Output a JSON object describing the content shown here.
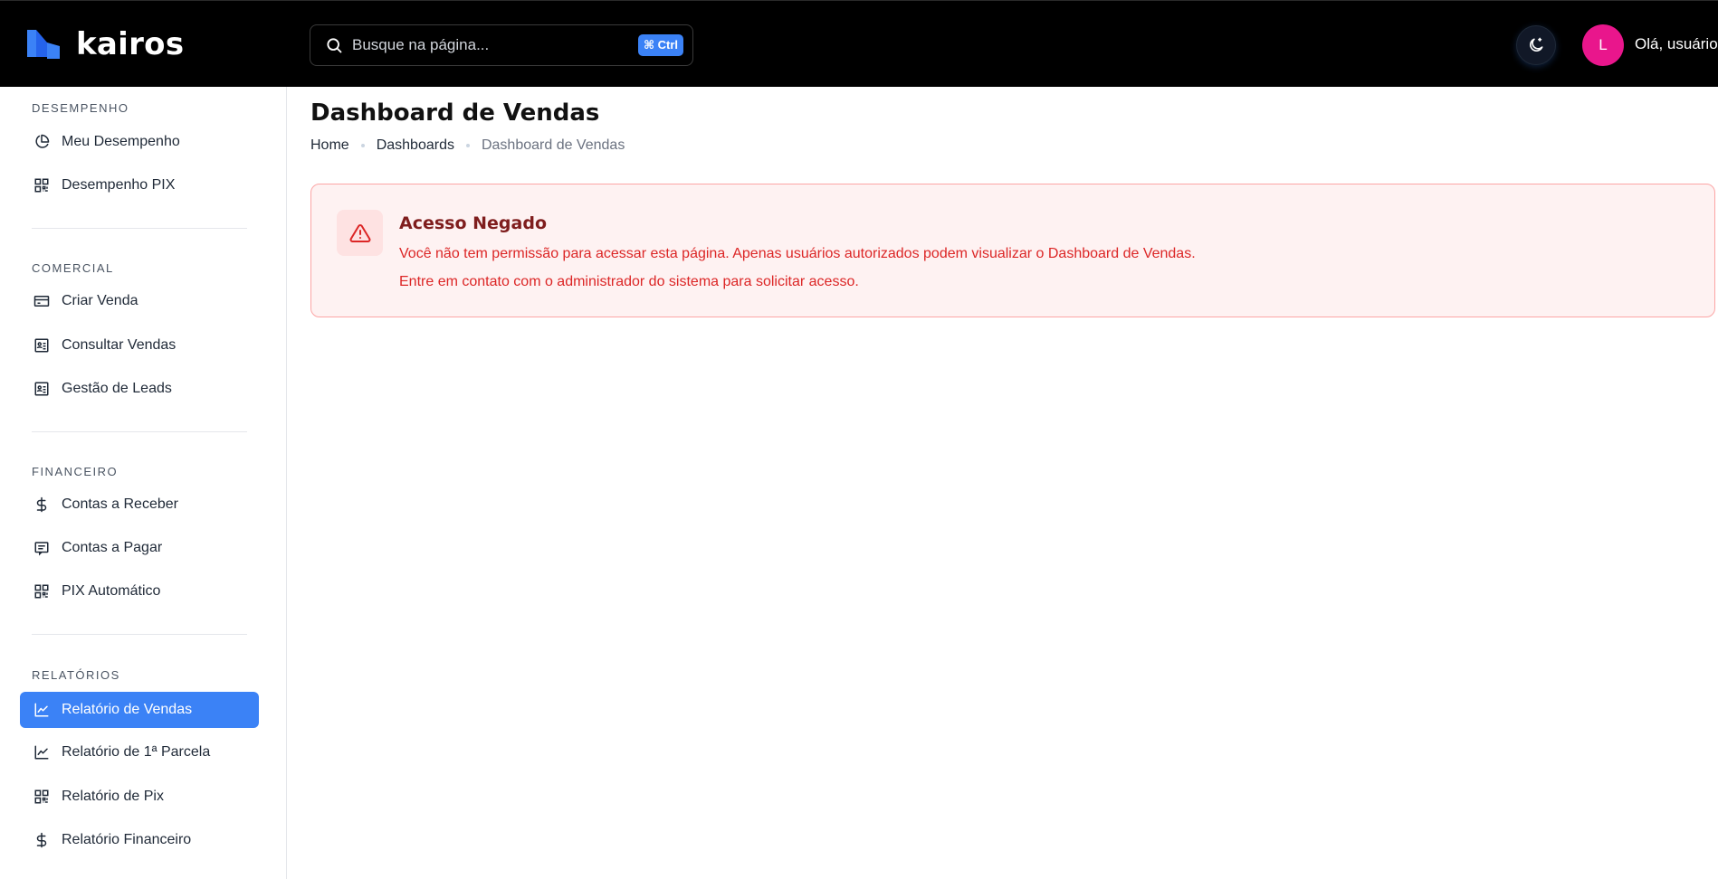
{
  "app": {
    "logo_text": "kairos"
  },
  "header": {
    "search_placeholder": "Busque na página...",
    "shortcut_label": "⌘ Ctrl",
    "theme_icon": "moon-icon",
    "avatar_initial": "L",
    "greeting": "Olá, usuário"
  },
  "sidebar": {
    "sections": [
      {
        "title": "DESEMPENHO",
        "items": [
          {
            "label": "Meu Desempenho",
            "icon": "pie-chart-icon"
          },
          {
            "label": "Desempenho PIX",
            "icon": "qr-code-icon"
          }
        ]
      },
      {
        "title": "COMERCIAL",
        "items": [
          {
            "label": "Criar Venda",
            "icon": "credit-card-icon"
          },
          {
            "label": "Consultar Vendas",
            "icon": "contact-card-icon"
          },
          {
            "label": "Gestão de Leads",
            "icon": "contact-card-icon"
          }
        ]
      },
      {
        "title": "FINANCEIRO",
        "items": [
          {
            "label": "Contas a Receber",
            "icon": "dollar-icon"
          },
          {
            "label": "Contas a Pagar",
            "icon": "receipt-icon"
          },
          {
            "label": "PIX Automático",
            "icon": "qr-code-icon"
          }
        ]
      },
      {
        "title": "RELATÓRIOS",
        "items": [
          {
            "label": "Relatório de Vendas",
            "icon": "line-chart-icon",
            "active": true
          },
          {
            "label": "Relatório de 1ª Parcela",
            "icon": "line-chart-icon"
          },
          {
            "label": "Relatório de Pix",
            "icon": "qr-code-icon"
          },
          {
            "label": "Relatório Financeiro",
            "icon": "dollar-icon"
          }
        ]
      }
    ]
  },
  "main": {
    "title": "Dashboard de Vendas",
    "breadcrumb": [
      "Home",
      "Dashboards",
      "Dashboard de Vendas"
    ],
    "alert": {
      "icon": "warning-icon",
      "title": "Acesso Negado",
      "message_1": "Você não tem permissão para acessar esta página. Apenas usuários autorizados podem visualizar o Dashboard de Vendas.",
      "message_2": "Entre em contato com o administrador do sistema para solicitar acesso."
    }
  },
  "colors": {
    "accent": "#3b82f6",
    "topbar": "#000000",
    "avatar": "#e9168c",
    "alert_bg": "#fef2f2",
    "alert_border": "#fca5a5",
    "alert_text": "#dc2626",
    "alert_title": "#7f1d1d"
  }
}
